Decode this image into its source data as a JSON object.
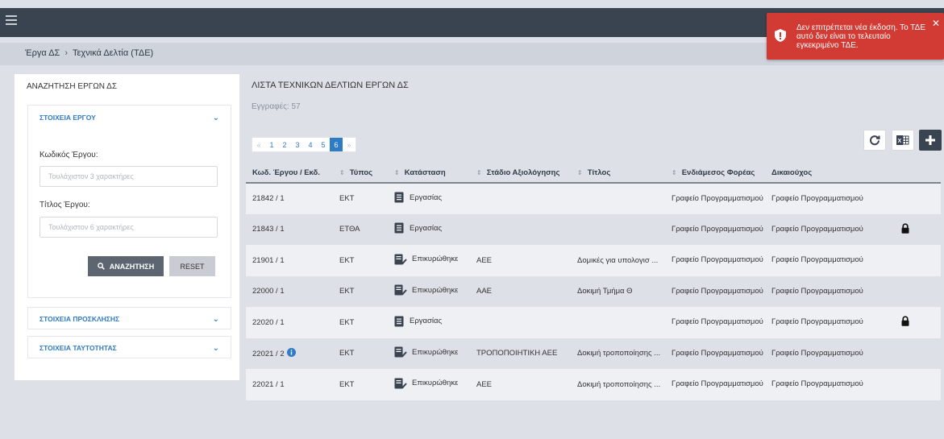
{
  "breadcrumb": [
    "Έργα ΔΣ",
    "Τεχνικά Δελτία (ΤΔΕ)"
  ],
  "toast": {
    "message": "Δεν επιτρέπεται νέα έκδοση. Το ΤΔΕ αυτό δεν είναι το τελευταίο εγκεκριμένο ΤΔΕ.",
    "close": "✕",
    "color": "#d23b34"
  },
  "left": {
    "title": "ΑΝΑΖΗΤΗΣΗ ΕΡΓΩΝ ΔΣ",
    "sections": {
      "project": "ΣΤΟΙΧΕΙΑ ΕΡΓΟΥ",
      "invitation": "ΣΤΟΙΧΕΙΑ ΠΡΟΣΚΛΗΣΗΣ",
      "identity": "ΣΤΟΙΧΕΙΑ ΤΑΥΤΟΤΗΤΑΣ"
    },
    "code_label": "Κωδικός Έργου:",
    "code_placeholder": "Τουλάχιστον 3 χαρακτήρες",
    "title_label": "Τίτλος Έργου:",
    "title_placeholder": "Τουλάχιστον 6 χαρακτήρες",
    "search_button": "ΑΝΑΖΗΤΗΣΗ",
    "reset_button": "RESET"
  },
  "main": {
    "title": "ΛΙΣΤΑ ΤΕΧΝΙΚΩΝ ΔΕΛΤΙΩΝ ΕΡΓΩΝ ΔΣ",
    "records": "Εγγραφές: 57",
    "pages": [
      "«",
      "1",
      "2",
      "3",
      "4",
      "5",
      "6",
      "»"
    ],
    "active_page": "6",
    "columns": [
      "Κωδ. Έργου / Εκδ.",
      "Τύπος",
      "Κατάσταση",
      "Στάδιο Αξιολόγησης",
      "Τίτλος",
      "Ενδιάμεσος Φορέας",
      "Δικαιούχος"
    ],
    "rows": [
      {
        "code": "21842 / 1",
        "info": false,
        "type": "ΕΚΤ",
        "status": "Εργασίας",
        "status_icon": "document-icon",
        "stage": "",
        "title": "",
        "intermediate": "Γραφείο Προγραμματισμού",
        "beneficiary": "Γραφείο Προγραμματισμού",
        "locked": false
      },
      {
        "code": "21843 / 1",
        "info": false,
        "type": "ΕΤΘΑ",
        "status": "Εργασίας",
        "status_icon": "document-icon",
        "stage": "",
        "title": "",
        "intermediate": "Γραφείο Προγραμματισμού",
        "beneficiary": "Γραφείο Προγραμματισμού",
        "locked": true
      },
      {
        "code": "21901 / 1",
        "info": false,
        "type": "ΕΚΤ",
        "status": "Επικυρώθηκε",
        "status_icon": "document-check-icon",
        "stage": "ΑΕΕ",
        "title": "Δομικές για υπολογισ ...",
        "intermediate": "Γραφείο Προγραμματισμού",
        "beneficiary": "Γραφείο Προγραμματισμού",
        "locked": false
      },
      {
        "code": "22000 / 1",
        "info": false,
        "type": "ΕΚΤ",
        "status": "Επικυρώθηκε",
        "status_icon": "document-check-icon",
        "stage": "ΑΑΕ",
        "title": "Δοκιμή Τμήμα Θ",
        "intermediate": "Γραφείο Προγραμματισμού",
        "beneficiary": "Γραφείο Προγραμματισμού",
        "locked": false
      },
      {
        "code": "22020 / 1",
        "info": false,
        "type": "ΕΚΤ",
        "status": "Εργασίας",
        "status_icon": "document-icon",
        "stage": "",
        "title": "",
        "intermediate": "Γραφείο Προγραμματισμού",
        "beneficiary": "Γραφείο Προγραμματισμού",
        "locked": true
      },
      {
        "code": "22021 / 2",
        "info": true,
        "type": "ΕΚΤ",
        "status": "Επικυρώθηκε",
        "status_icon": "document-check-icon",
        "stage": "ΤΡΟΠΟΠΟΙΗΤΙΚΗ ΑΕΕ",
        "title": "Δοκιμή τροποποίησης ...",
        "intermediate": "Γραφείο Προγραμματισμού",
        "beneficiary": "Γραφείο Προγραμματισμού",
        "locked": false
      },
      {
        "code": "22021 / 1",
        "info": false,
        "type": "ΕΚΤ",
        "status": "Επικυρώθηκε",
        "status_icon": "document-check-icon",
        "stage": "ΑΕΕ",
        "title": "Δοκιμή τροποποίησης ...",
        "intermediate": "Γραφείο Προγραμματισμού",
        "beneficiary": "Γραφείο Προγραμματισμού",
        "locked": false
      }
    ]
  },
  "colors": {
    "accent": "#2e7bc6",
    "topbar": "#3a4450",
    "toast": "#d23b34"
  }
}
